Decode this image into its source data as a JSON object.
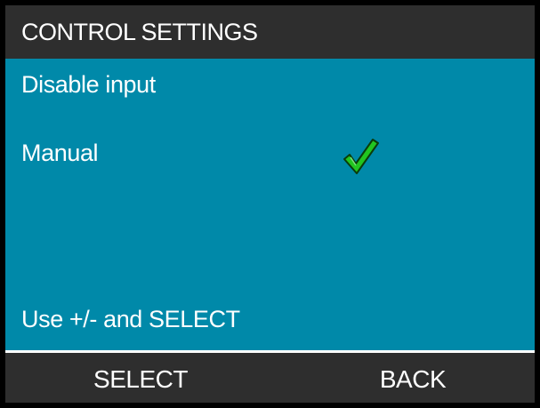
{
  "screen": {
    "title": "CONTROL SETTINGS",
    "menu": [
      {
        "label": "Disable input",
        "checked": false
      },
      {
        "label": "Manual",
        "checked": true
      }
    ],
    "checkmark_icon": "check-icon",
    "hint": "Use +/- and SELECT"
  },
  "softkeys": {
    "left": "SELECT",
    "right": "BACK"
  },
  "colors": {
    "title_bar": "#2e2e2e",
    "content_background": "#0089a9",
    "checkmark_fill": "#22c520",
    "checkmark_outline": "#0a3d0a",
    "text": "#ffffff"
  }
}
